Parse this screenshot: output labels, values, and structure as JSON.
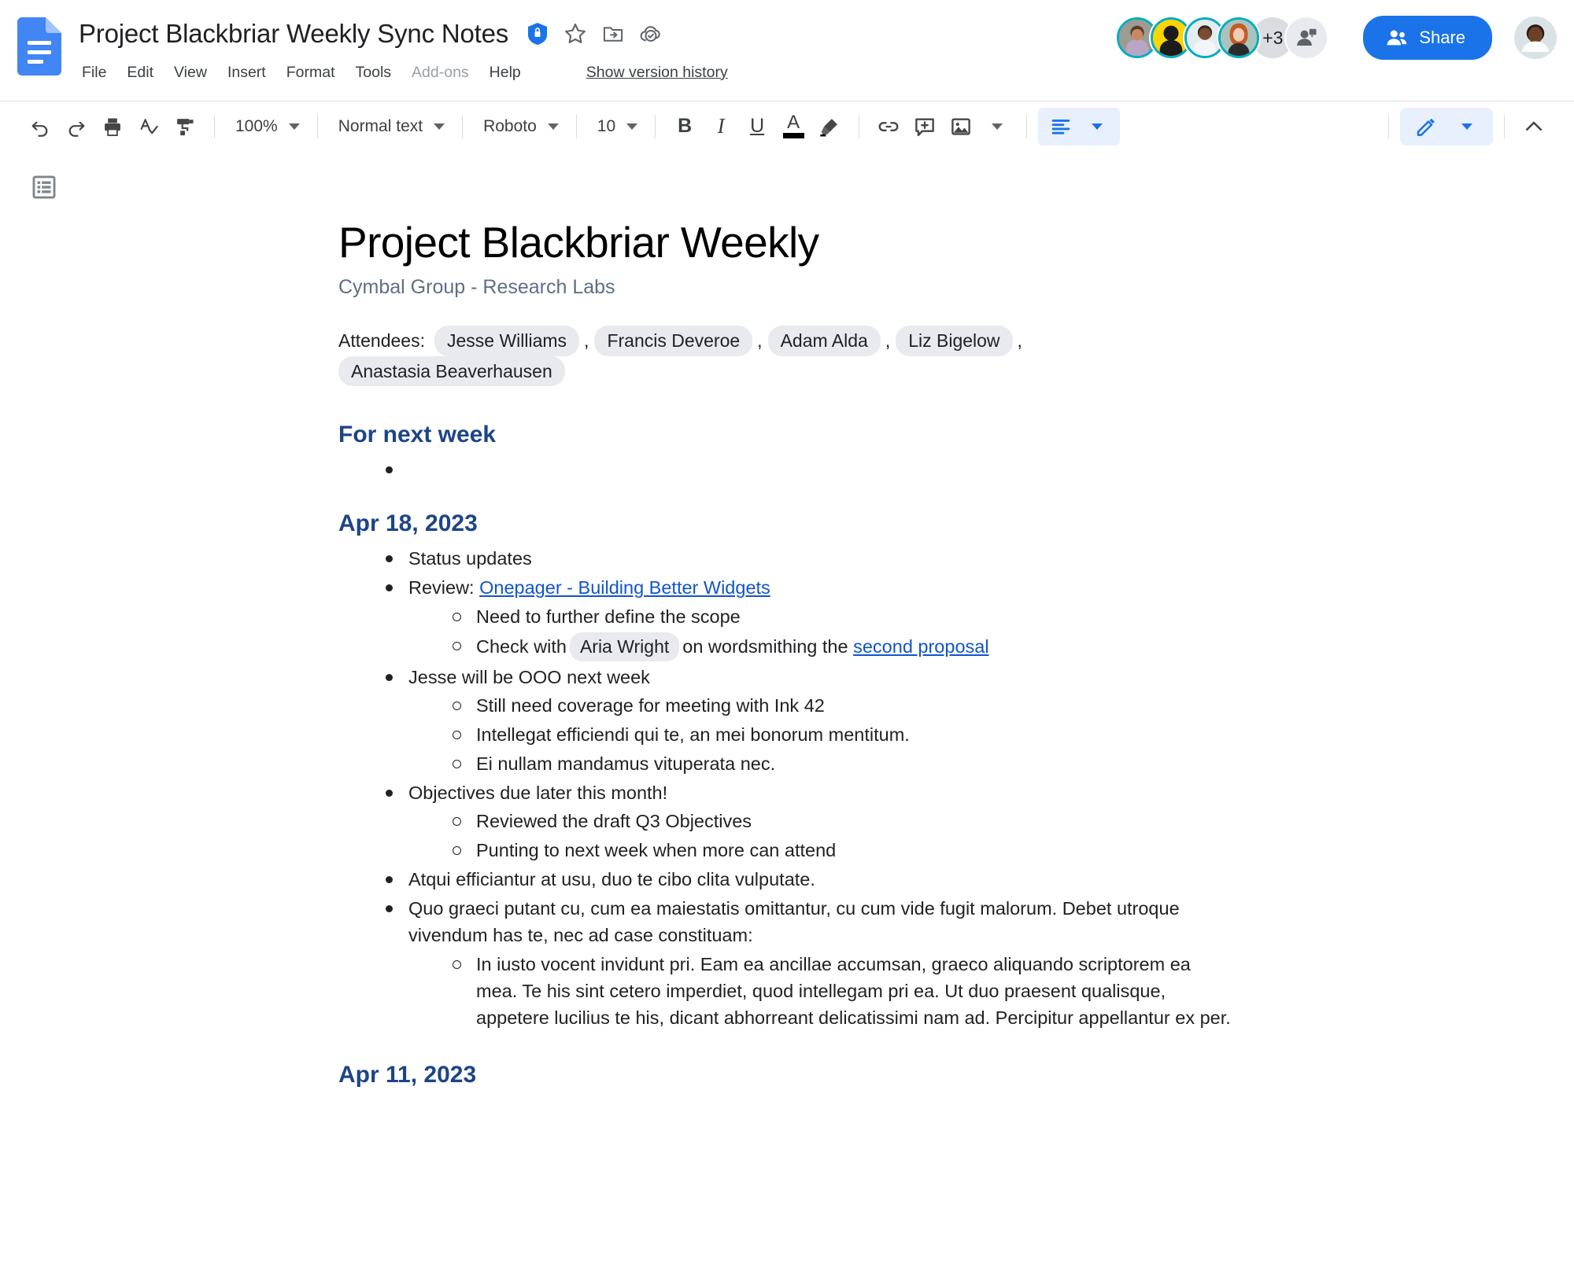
{
  "header": {
    "doc_title": "Project Blackbriar Weekly Sync Notes",
    "title_icons": [
      "shield-lock-icon",
      "star-icon",
      "move-to-folder-icon",
      "cloud-saved-icon"
    ],
    "menus": [
      {
        "label": "File",
        "disabled": false
      },
      {
        "label": "Edit",
        "disabled": false
      },
      {
        "label": "View",
        "disabled": false
      },
      {
        "label": "Insert",
        "disabled": false
      },
      {
        "label": "Format",
        "disabled": false
      },
      {
        "label": "Tools",
        "disabled": false
      },
      {
        "label": "Add-ons",
        "disabled": true
      },
      {
        "label": "Help",
        "disabled": false
      }
    ],
    "version_history": "Show version history",
    "collaborators_overflow": "+3",
    "share_label": "Share"
  },
  "toolbar": {
    "zoom_level": "100%",
    "paragraph_style": "Normal text",
    "font_family": "Roboto",
    "font_size": "10",
    "buttons": [
      "undo-icon",
      "redo-icon",
      "print-icon",
      "spellcheck-icon",
      "paint-format-icon",
      "bold-icon",
      "italic-icon",
      "underline-icon",
      "text-color-icon",
      "highlight-icon",
      "insert-link-icon",
      "add-comment-icon",
      "insert-image-icon",
      "align-icon",
      "editing-mode-icon",
      "collapse-toolbar-icon"
    ],
    "bold_label": "B",
    "italic_label": "I",
    "underline_label": "U",
    "text_color_label": "A",
    "text_color": "#000000",
    "accent_color": "#1a73e8",
    "active_bg": "#e8f0fe"
  },
  "document": {
    "title": "Project Blackbriar Weekly",
    "subtitle": "Cymbal Group - Research Labs",
    "attendees_label": "Attendees:",
    "attendees": [
      "Jesse Williams",
      "Francis Deveroe",
      "Adam Alda",
      "Liz Bigelow",
      "Anastasia Beaverhausen"
    ],
    "sections": [
      {
        "heading": "For next week",
        "items": []
      },
      {
        "heading": "Apr 18, 2023",
        "items": [
          {
            "text": "Status updates",
            "children": []
          },
          {
            "prefix": "Review: ",
            "link": "Onepager - Building Better Widgets",
            "children": [
              {
                "text": "Need to further define the scope"
              },
              {
                "pre": "Check with",
                "chip": "Aria Wright",
                "mid": "on wordsmithing the",
                "link": "second proposal"
              }
            ]
          },
          {
            "text": "Jesse will be OOO next week",
            "children": [
              {
                "text": "Still need coverage for meeting with Ink 42"
              },
              {
                "text": "Intellegat efficiendi qui te, an mei bonorum mentitum."
              },
              {
                "text": "Ei nullam mandamus vituperata nec."
              }
            ]
          },
          {
            "text": "Objectives due later this month!",
            "children": [
              {
                "text": "Reviewed the draft Q3 Objectives"
              },
              {
                "text": "Punting to next week when more can attend"
              }
            ]
          },
          {
            "text": "Atqui efficiantur at usu, duo te cibo clita vulputate.",
            "children": []
          },
          {
            "text": "Quo graeci putant cu, cum ea maiestatis omittantur, cu cum vide fugit malorum. Debet utroque vivendum has te, nec ad case constituam:",
            "children": [
              {
                "text": "In iusto vocent invidunt pri. Eam ea ancillae accumsan, graeco aliquando scriptorem ea mea. Te his sint cetero imperdiet, quod intellegam pri ea. Ut duo praesent qualisque, appetere lucilius te his, dicant abhorreant delicatissimi nam ad. Percipitur appellantur ex per."
              }
            ]
          }
        ]
      },
      {
        "heading": "Apr 11, 2023",
        "items": []
      }
    ]
  }
}
